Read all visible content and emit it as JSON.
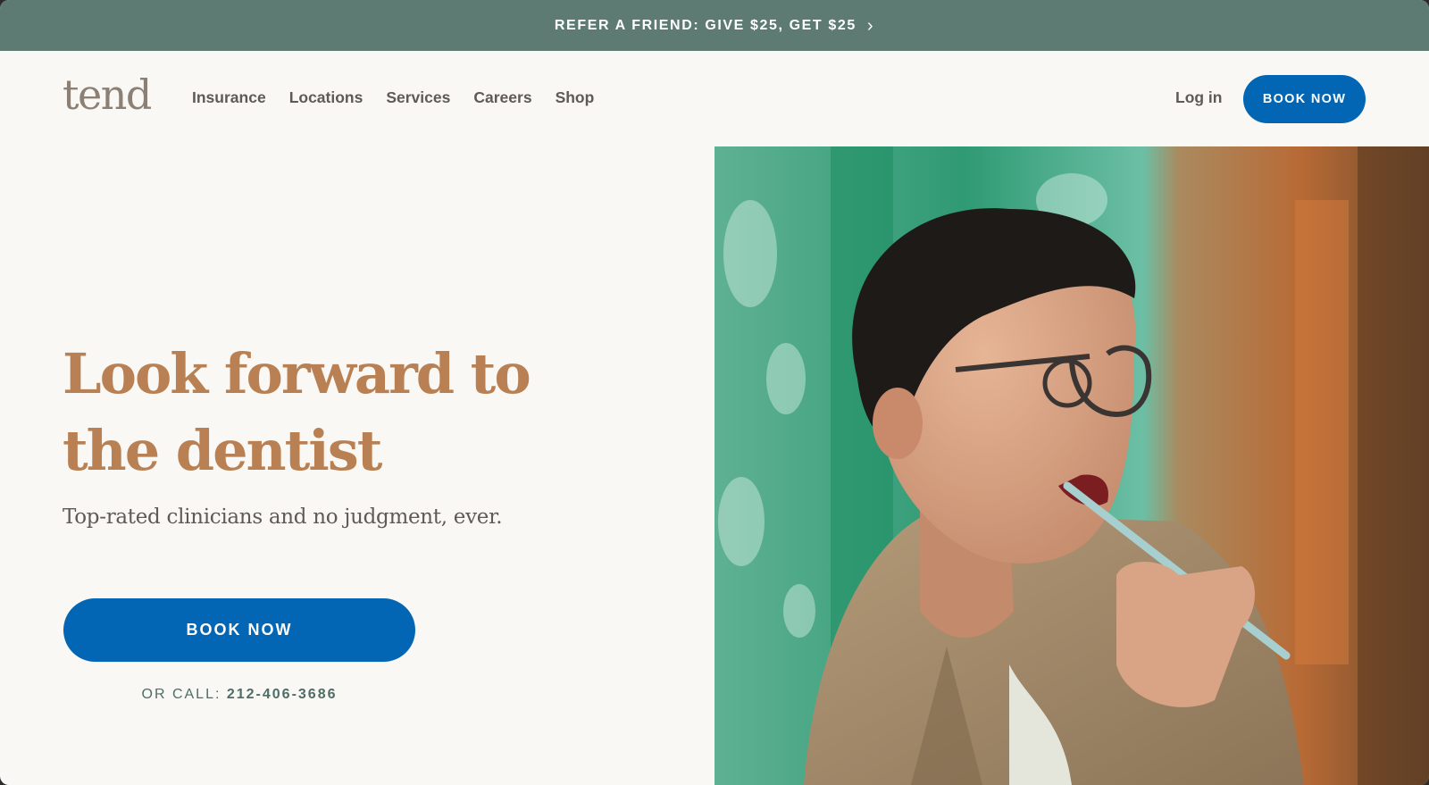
{
  "promo_banner": {
    "text": "REFER A FRIEND: GIVE $25, GET $25",
    "chevron": "›",
    "icon": "chevron-right-icon"
  },
  "header": {
    "logo": "tend",
    "nav": [
      {
        "label": "Insurance"
      },
      {
        "label": "Locations"
      },
      {
        "label": "Services"
      },
      {
        "label": "Careers"
      },
      {
        "label": "Shop"
      }
    ],
    "login_label": "Log in",
    "book_label": "BOOK NOW"
  },
  "hero": {
    "headline_line1": "Look forward to",
    "headline_line2": "the dentist",
    "subheadline": "Top-rated clinicians and no judgment, ever.",
    "cta_label": "BOOK NOW",
    "call_prefix": "OR CALL: ",
    "phone": "212-406-3686"
  },
  "colors": {
    "promo_bg": "#5d7b73",
    "page_bg": "#f9f8f5",
    "accent_blue": "#0266b5",
    "headline": "#b98153",
    "nav_text": "#5f5a56"
  }
}
